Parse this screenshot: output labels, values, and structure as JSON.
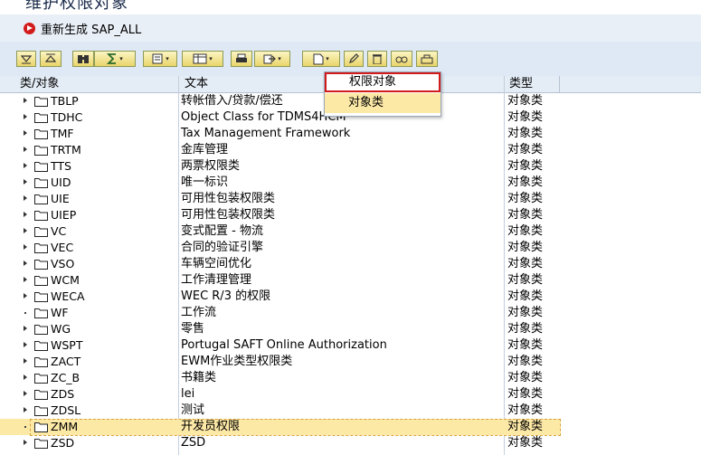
{
  "window": {
    "title": "维护权限对象"
  },
  "appbar": {
    "regen_label": "重新生成 SAP_ALL"
  },
  "toolbar": {
    "buttons": [
      "expand-all-icon",
      "collapse-all-icon",
      "binoculars-icon",
      "sum-icon",
      "print-preview-icon",
      "layout-icon",
      "printer-icon",
      "export-icon",
      "new-icon",
      "edit-icon",
      "delete-icon",
      "glasses-icon",
      "transport-icon"
    ]
  },
  "columns": {
    "class": "类/对象",
    "text": "文本",
    "type": "类型"
  },
  "menu": {
    "item1": "权限对象",
    "item2": "对象类"
  },
  "rows": [
    {
      "name": "TBLP",
      "text": "转帐借入/贷款/偿还",
      "type": "对象类",
      "expand": "arrow"
    },
    {
      "name": "TDHC",
      "text": "Object Class for TDMS4HCM",
      "type": "对象类",
      "expand": "arrow"
    },
    {
      "name": "TMF",
      "text": "Tax Management Framework",
      "type": "对象类",
      "expand": "arrow"
    },
    {
      "name": "TRTM",
      "text": "金库管理",
      "type": "对象类",
      "expand": "arrow"
    },
    {
      "name": "TTS",
      "text": "两票权限类",
      "type": "对象类",
      "expand": "arrow"
    },
    {
      "name": "UID",
      "text": "唯一标识",
      "type": "对象类",
      "expand": "arrow"
    },
    {
      "name": "UIE",
      "text": "可用性包装权限类",
      "type": "对象类",
      "expand": "arrow"
    },
    {
      "name": "UIEP",
      "text": "可用性包装权限类",
      "type": "对象类",
      "expand": "arrow"
    },
    {
      "name": "VC",
      "text": "变式配置 - 物流",
      "type": "对象类",
      "expand": "arrow"
    },
    {
      "name": "VEC",
      "text": "合同的验证引擎",
      "type": "对象类",
      "expand": "arrow"
    },
    {
      "name": "VSO",
      "text": "车辆空间优化",
      "type": "对象类",
      "expand": "arrow"
    },
    {
      "name": "WCM",
      "text": "工作清理管理",
      "type": "对象类",
      "expand": "arrow"
    },
    {
      "name": "WECA",
      "text": "WEC R/3 的权限",
      "type": "对象类",
      "expand": "arrow"
    },
    {
      "name": "WF",
      "text": "工作流",
      "type": "对象类",
      "expand": "dot"
    },
    {
      "name": "WG",
      "text": "零售",
      "type": "对象类",
      "expand": "arrow"
    },
    {
      "name": "WSPT",
      "text": "Portugal SAFT Online Authorization",
      "type": "对象类",
      "expand": "arrow"
    },
    {
      "name": "ZACT",
      "text": "EWM作业类型权限类",
      "type": "对象类",
      "expand": "arrow"
    },
    {
      "name": "ZC_B",
      "text": "书籍类",
      "type": "对象类",
      "expand": "arrow"
    },
    {
      "name": "ZDS",
      "text": "lei",
      "type": "对象类",
      "expand": "arrow"
    },
    {
      "name": "ZDSL",
      "text": "测试",
      "type": "对象类",
      "expand": "arrow"
    },
    {
      "name": "ZMM",
      "text": "开发员权限",
      "type": "对象类",
      "expand": "dot",
      "selected": true
    },
    {
      "name": "ZSD",
      "text": "ZSD",
      "type": "对象类",
      "expand": "arrow"
    }
  ]
}
